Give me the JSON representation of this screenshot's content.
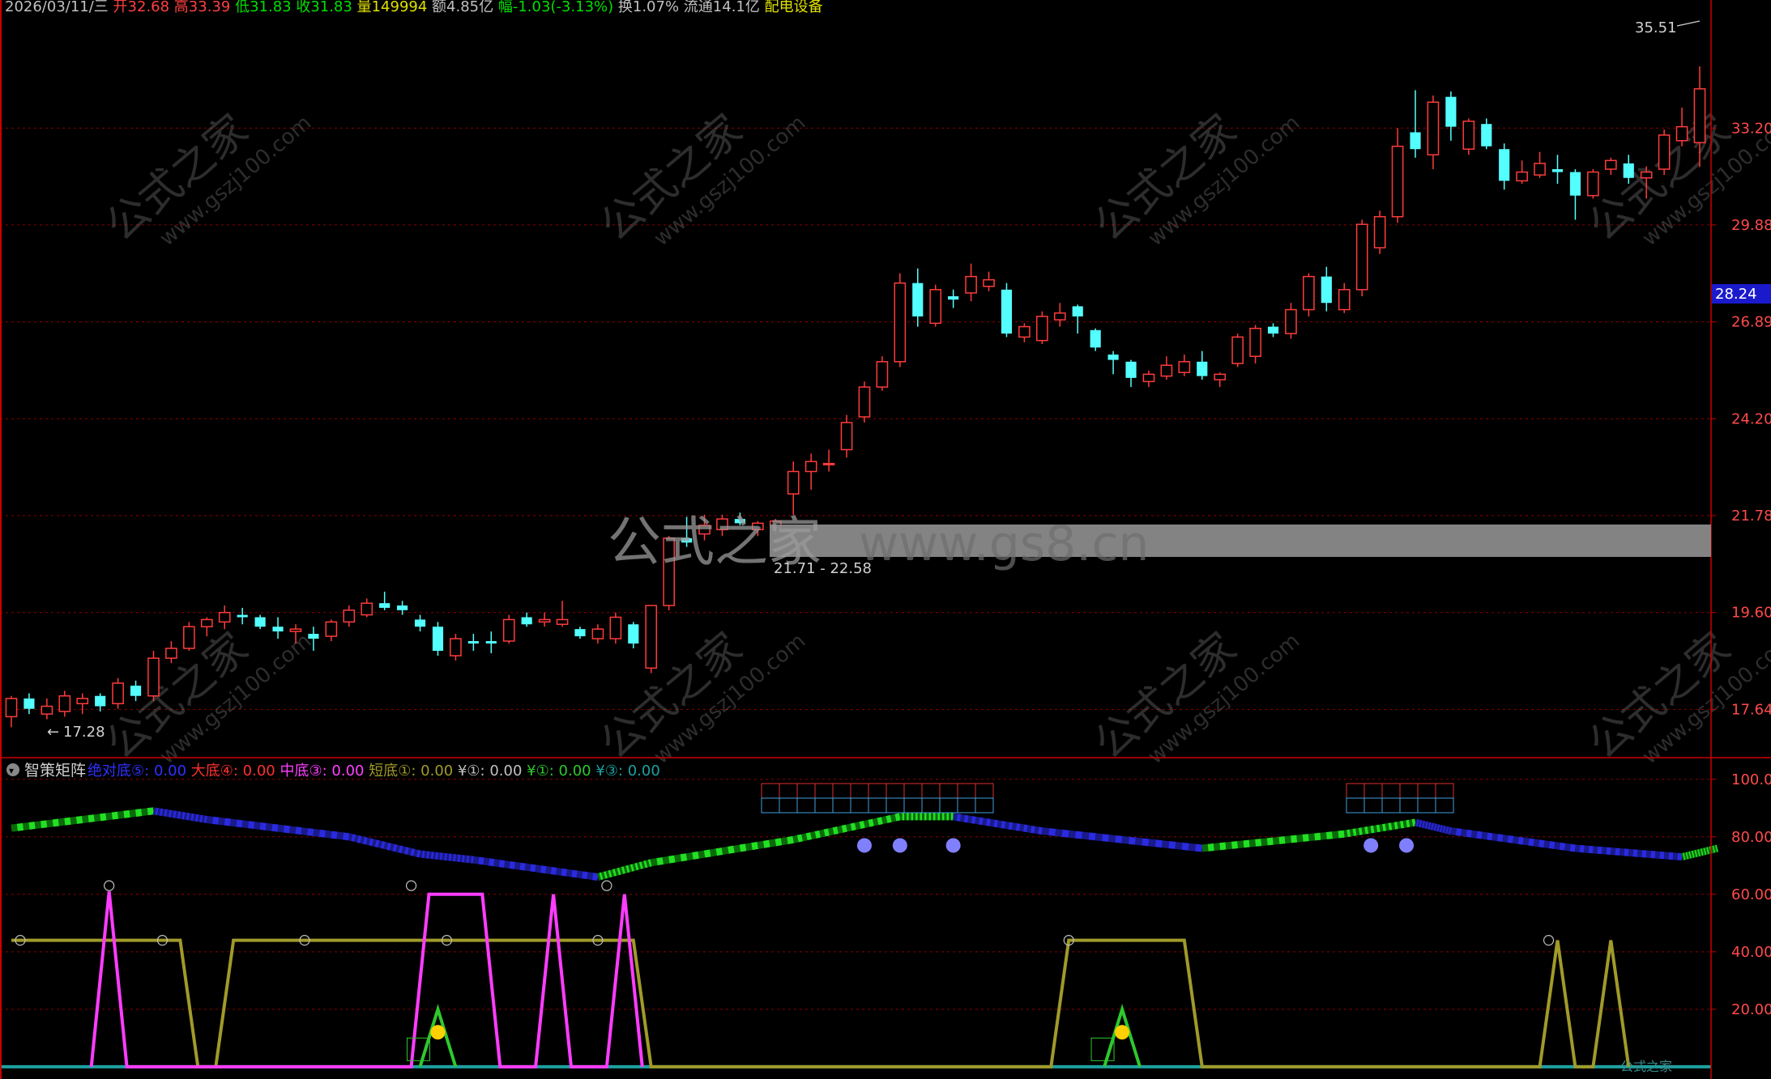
{
  "header": {
    "items": [
      {
        "text": "2026/03/11/三",
        "color": "#c0c0c0"
      },
      {
        "text": "开32.68",
        "color": "#ff4040"
      },
      {
        "text": "高33.39",
        "color": "#ff4040"
      },
      {
        "text": "低31.83",
        "color": "#00e000"
      },
      {
        "text": "收31.83",
        "color": "#00e000"
      },
      {
        "text": "量149994",
        "color": "#e0e000"
      },
      {
        "text": "额4.85亿",
        "color": "#c0c0c0"
      },
      {
        "text": "幅-1.03(-3.13%)",
        "color": "#00e000"
      },
      {
        "text": "换1.07%",
        "color": "#c0c0c0"
      },
      {
        "text": "流通14.1亿",
        "color": "#c0c0c0"
      },
      {
        "text": "配电设备",
        "color": "#e0e000"
      }
    ]
  },
  "colors": {
    "up": "#ff3b3b",
    "down": "#54ffff",
    "grid": "#8b0000",
    "axis": "#cc0000",
    "price_label_bg": "#1a1acc",
    "magenta": "#ff3cff",
    "olive": "#a09a2a",
    "green": "#2ec82e",
    "teal": "#1ea0a0",
    "zigzag_green": "#22e022",
    "zigzag_blue": "#2a2ae0"
  },
  "watermarks": {
    "main": "公式之家",
    "url": "www.gszj100.com",
    "center_main": "公式之家",
    "center_url": "www.gs8.cn",
    "corner": "公式之家"
  },
  "chart_data": [
    {
      "type": "candlestick",
      "title": "",
      "y_ticks": [
        "17.64",
        "19.60",
        "21.78",
        "24.20",
        "26.89",
        "29.88",
        "33.20"
      ],
      "ylim": [
        16.9,
        37.5
      ],
      "current_price": "28.24",
      "max_marker": "35.51",
      "min_marker": "17.28",
      "range_label": "21.71 - 22.58",
      "candles": [
        {
          "o": 17.5,
          "h": 17.9,
          "l": 17.3,
          "c": 17.85
        },
        {
          "o": 17.85,
          "h": 17.95,
          "l": 17.55,
          "c": 17.65
        },
        {
          "o": 17.55,
          "h": 17.85,
          "l": 17.45,
          "c": 17.7
        },
        {
          "o": 17.6,
          "h": 18.0,
          "l": 17.5,
          "c": 17.9
        },
        {
          "o": 17.75,
          "h": 17.95,
          "l": 17.55,
          "c": 17.85
        },
        {
          "o": 17.9,
          "h": 17.95,
          "l": 17.6,
          "c": 17.7
        },
        {
          "o": 17.75,
          "h": 18.25,
          "l": 17.65,
          "c": 18.15
        },
        {
          "o": 18.1,
          "h": 18.2,
          "l": 17.8,
          "c": 17.9
        },
        {
          "o": 17.9,
          "h": 18.8,
          "l": 17.8,
          "c": 18.65
        },
        {
          "o": 18.65,
          "h": 19.0,
          "l": 18.55,
          "c": 18.85
        },
        {
          "o": 18.85,
          "h": 19.4,
          "l": 18.8,
          "c": 19.3
        },
        {
          "o": 19.3,
          "h": 19.5,
          "l": 19.1,
          "c": 19.45
        },
        {
          "o": 19.4,
          "h": 19.75,
          "l": 19.25,
          "c": 19.6
        },
        {
          "o": 19.55,
          "h": 19.7,
          "l": 19.35,
          "c": 19.5
        },
        {
          "o": 19.5,
          "h": 19.55,
          "l": 19.25,
          "c": 19.3
        },
        {
          "o": 19.3,
          "h": 19.5,
          "l": 19.05,
          "c": 19.2
        },
        {
          "o": 19.2,
          "h": 19.35,
          "l": 18.95,
          "c": 19.25
        },
        {
          "o": 19.15,
          "h": 19.3,
          "l": 18.8,
          "c": 19.05
        },
        {
          "o": 19.1,
          "h": 19.45,
          "l": 19.0,
          "c": 19.4
        },
        {
          "o": 19.4,
          "h": 19.75,
          "l": 19.3,
          "c": 19.65
        },
        {
          "o": 19.55,
          "h": 19.9,
          "l": 19.5,
          "c": 19.8
        },
        {
          "o": 19.8,
          "h": 20.05,
          "l": 19.65,
          "c": 19.7
        },
        {
          "o": 19.75,
          "h": 19.85,
          "l": 19.55,
          "c": 19.65
        },
        {
          "o": 19.45,
          "h": 19.55,
          "l": 19.2,
          "c": 19.3
        },
        {
          "o": 19.3,
          "h": 19.4,
          "l": 18.7,
          "c": 18.8
        },
        {
          "o": 18.7,
          "h": 19.15,
          "l": 18.6,
          "c": 19.05
        },
        {
          "o": 19.0,
          "h": 19.15,
          "l": 18.8,
          "c": 18.95
        },
        {
          "o": 19.0,
          "h": 19.2,
          "l": 18.75,
          "c": 18.95
        },
        {
          "o": 19.0,
          "h": 19.55,
          "l": 18.95,
          "c": 19.45
        },
        {
          "o": 19.5,
          "h": 19.6,
          "l": 19.3,
          "c": 19.35
        },
        {
          "o": 19.4,
          "h": 19.6,
          "l": 19.3,
          "c": 19.45
        },
        {
          "o": 19.35,
          "h": 19.85,
          "l": 19.3,
          "c": 19.45
        },
        {
          "o": 19.25,
          "h": 19.3,
          "l": 19.05,
          "c": 19.1
        },
        {
          "o": 19.05,
          "h": 19.35,
          "l": 18.95,
          "c": 19.25
        },
        {
          "o": 19.05,
          "h": 19.6,
          "l": 18.95,
          "c": 19.5
        },
        {
          "o": 19.35,
          "h": 19.4,
          "l": 18.85,
          "c": 18.95
        },
        {
          "o": 18.45,
          "h": 19.75,
          "l": 18.35,
          "c": 19.75
        },
        {
          "o": 19.75,
          "h": 21.3,
          "l": 19.65,
          "c": 21.25
        },
        {
          "o": 21.25,
          "h": 21.75,
          "l": 21.05,
          "c": 21.15
        },
        {
          "o": 21.35,
          "h": 21.8,
          "l": 21.2,
          "c": 21.55
        },
        {
          "o": 21.45,
          "h": 21.8,
          "l": 21.3,
          "c": 21.7
        },
        {
          "o": 21.7,
          "h": 21.85,
          "l": 21.55,
          "c": 21.6
        },
        {
          "o": 21.45,
          "h": 21.65,
          "l": 21.3,
          "c": 21.6
        },
        {
          "o": 21.5,
          "h": 21.7,
          "l": 21.35,
          "c": 21.65
        },
        {
          "o": 22.3,
          "h": 23.1,
          "l": 21.8,
          "c": 22.85
        },
        {
          "o": 22.85,
          "h": 23.3,
          "l": 22.4,
          "c": 23.1
        },
        {
          "o": 23.05,
          "h": 23.4,
          "l": 22.85,
          "c": 23.05
        },
        {
          "o": 23.4,
          "h": 24.3,
          "l": 23.2,
          "c": 24.1
        },
        {
          "o": 24.25,
          "h": 25.2,
          "l": 24.1,
          "c": 25.05
        },
        {
          "o": 25.05,
          "h": 25.9,
          "l": 24.95,
          "c": 25.75
        },
        {
          "o": 25.75,
          "h": 28.35,
          "l": 25.6,
          "c": 28.05
        },
        {
          "o": 28.05,
          "h": 28.5,
          "l": 26.75,
          "c": 27.05
        },
        {
          "o": 26.85,
          "h": 28.0,
          "l": 26.75,
          "c": 27.85
        },
        {
          "o": 27.65,
          "h": 27.85,
          "l": 27.3,
          "c": 27.55
        },
        {
          "o": 27.75,
          "h": 28.65,
          "l": 27.5,
          "c": 28.25
        },
        {
          "o": 27.95,
          "h": 28.4,
          "l": 27.8,
          "c": 28.15
        },
        {
          "o": 27.85,
          "h": 28.05,
          "l": 26.45,
          "c": 26.55
        },
        {
          "o": 26.45,
          "h": 26.85,
          "l": 26.3,
          "c": 26.75
        },
        {
          "o": 26.35,
          "h": 27.2,
          "l": 26.25,
          "c": 27.05
        },
        {
          "o": 26.95,
          "h": 27.45,
          "l": 26.75,
          "c": 27.15
        },
        {
          "o": 27.35,
          "h": 27.4,
          "l": 26.55,
          "c": 27.05
        },
        {
          "o": 26.65,
          "h": 26.7,
          "l": 26.05,
          "c": 26.15
        },
        {
          "o": 25.95,
          "h": 26.05,
          "l": 25.4,
          "c": 25.8
        },
        {
          "o": 25.75,
          "h": 25.8,
          "l": 25.05,
          "c": 25.3
        },
        {
          "o": 25.2,
          "h": 25.5,
          "l": 25.05,
          "c": 25.4
        },
        {
          "o": 25.35,
          "h": 25.9,
          "l": 25.25,
          "c": 25.65
        },
        {
          "o": 25.45,
          "h": 25.95,
          "l": 25.35,
          "c": 25.75
        },
        {
          "o": 25.75,
          "h": 26.05,
          "l": 25.25,
          "c": 25.35
        },
        {
          "o": 25.25,
          "h": 25.45,
          "l": 25.05,
          "c": 25.4
        },
        {
          "o": 25.7,
          "h": 26.55,
          "l": 25.6,
          "c": 26.45
        },
        {
          "o": 25.9,
          "h": 26.8,
          "l": 25.7,
          "c": 26.7
        },
        {
          "o": 26.75,
          "h": 26.85,
          "l": 26.45,
          "c": 26.55
        },
        {
          "o": 26.55,
          "h": 27.45,
          "l": 26.4,
          "c": 27.25
        },
        {
          "o": 27.25,
          "h": 28.35,
          "l": 27.05,
          "c": 28.25
        },
        {
          "o": 28.25,
          "h": 28.55,
          "l": 27.2,
          "c": 27.45
        },
        {
          "o": 27.25,
          "h": 28.05,
          "l": 27.15,
          "c": 27.85
        },
        {
          "o": 27.85,
          "h": 30.05,
          "l": 27.65,
          "c": 29.9
        },
        {
          "o": 29.15,
          "h": 30.35,
          "l": 28.95,
          "c": 30.15
        },
        {
          "o": 30.15,
          "h": 33.2,
          "l": 29.95,
          "c": 32.55
        },
        {
          "o": 33.05,
          "h": 34.6,
          "l": 32.15,
          "c": 32.45
        },
        {
          "o": 32.25,
          "h": 34.4,
          "l": 31.75,
          "c": 34.15
        },
        {
          "o": 34.35,
          "h": 34.55,
          "l": 32.75,
          "c": 33.25
        },
        {
          "o": 32.45,
          "h": 33.55,
          "l": 32.25,
          "c": 33.45
        },
        {
          "o": 33.35,
          "h": 33.55,
          "l": 32.45,
          "c": 32.55
        },
        {
          "o": 32.45,
          "h": 32.65,
          "l": 31.05,
          "c": 31.35
        },
        {
          "o": 31.35,
          "h": 32.05,
          "l": 31.25,
          "c": 31.65
        },
        {
          "o": 31.55,
          "h": 32.35,
          "l": 31.45,
          "c": 31.95
        },
        {
          "o": 31.75,
          "h": 32.25,
          "l": 31.25,
          "c": 31.65
        },
        {
          "o": 31.65,
          "h": 31.75,
          "l": 30.05,
          "c": 30.85
        },
        {
          "o": 30.85,
          "h": 31.75,
          "l": 30.75,
          "c": 31.65
        },
        {
          "o": 31.75,
          "h": 32.15,
          "l": 31.55,
          "c": 32.05
        },
        {
          "o": 31.95,
          "h": 32.25,
          "l": 31.25,
          "c": 31.45
        },
        {
          "o": 31.45,
          "h": 31.85,
          "l": 30.75,
          "c": 31.65
        },
        {
          "o": 31.75,
          "h": 33.15,
          "l": 31.55,
          "c": 32.95
        },
        {
          "o": 32.75,
          "h": 33.95,
          "l": 32.55,
          "c": 33.25
        },
        {
          "o": 32.68,
          "h": 35.51,
          "l": 31.83,
          "c": 34.65
        }
      ]
    },
    {
      "type": "line",
      "title": "智策矩阵",
      "legend": [
        {
          "label": "绝对底⑤:",
          "value": "0.00",
          "color": "#3030ff"
        },
        {
          "label": "大底④:",
          "value": "0.00",
          "color": "#ff3030"
        },
        {
          "label": "中底③:",
          "value": "0.00",
          "color": "#ff40ff"
        },
        {
          "label": "短底①:",
          "value": "0.00",
          "color": "#a09a2a"
        },
        {
          "label": "¥①:",
          "value": "0.00",
          "color": "#c0c0c0"
        },
        {
          "label": "¥①:",
          "value": "0.00",
          "color": "#2ec82e"
        },
        {
          "label": "¥③:",
          "value": "0.00",
          "color": "#1ea0a0"
        }
      ],
      "y_ticks": [
        "100.0",
        "80.00",
        "60.00",
        "40.00",
        "20.00"
      ],
      "ylim": [
        -2,
        105
      ],
      "zigzag": [
        {
          "x": 0,
          "y": 83
        },
        {
          "x": 8,
          "y": 89
        },
        {
          "x": 11,
          "y": 86
        },
        {
          "x": 19,
          "y": 80
        },
        {
          "x": 23,
          "y": 74
        },
        {
          "x": 26,
          "y": 72
        },
        {
          "x": 33,
          "y": 66
        },
        {
          "x": 36,
          "y": 71
        },
        {
          "x": 44,
          "y": 79
        },
        {
          "x": 50,
          "y": 87
        },
        {
          "x": 53,
          "y": 87
        },
        {
          "x": 58,
          "y": 82
        },
        {
          "x": 67,
          "y": 76
        },
        {
          "x": 75,
          "y": 81
        },
        {
          "x": 79,
          "y": 85
        },
        {
          "x": 81,
          "y": 82
        },
        {
          "x": 88,
          "y": 76
        },
        {
          "x": 94,
          "y": 73
        },
        {
          "x": 96,
          "y": 76
        }
      ],
      "magenta": [
        {
          "x": 4.5,
          "y": 0
        },
        {
          "x": 5.5,
          "y": 61
        },
        {
          "x": 6.5,
          "y": 0
        },
        {
          "x": 22.5,
          "y": 0
        },
        {
          "x": 23.5,
          "y": 60
        },
        {
          "x": 26.5,
          "y": 60
        },
        {
          "x": 27.5,
          "y": 0
        },
        {
          "x": 29.5,
          "y": 0
        },
        {
          "x": 30.5,
          "y": 60
        },
        {
          "x": 31.5,
          "y": 0
        },
        {
          "x": 33.5,
          "y": 0
        },
        {
          "x": 34.5,
          "y": 60
        },
        {
          "x": 35.5,
          "y": 0
        }
      ],
      "olive": [
        {
          "x": 0,
          "y": 44
        },
        {
          "x": 9.5,
          "y": 44
        },
        {
          "x": 10.5,
          "y": 0
        },
        {
          "x": 11.5,
          "y": 0
        },
        {
          "x": 12.5,
          "y": 44
        },
        {
          "x": 35,
          "y": 44
        },
        {
          "x": 36,
          "y": 0
        },
        {
          "x": 58.5,
          "y": 0
        },
        {
          "x": 59.5,
          "y": 44
        },
        {
          "x": 66,
          "y": 44
        },
        {
          "x": 67,
          "y": 0
        },
        {
          "x": 86,
          "y": 0
        },
        {
          "x": 87,
          "y": 44
        },
        {
          "x": 88,
          "y": 0
        },
        {
          "x": 89,
          "y": 0
        },
        {
          "x": 90,
          "y": 44
        },
        {
          "x": 91,
          "y": 0
        }
      ],
      "green_peaks": [
        {
          "x": 24,
          "y": 20
        },
        {
          "x": 62.5,
          "y": 20
        }
      ]
    }
  ]
}
